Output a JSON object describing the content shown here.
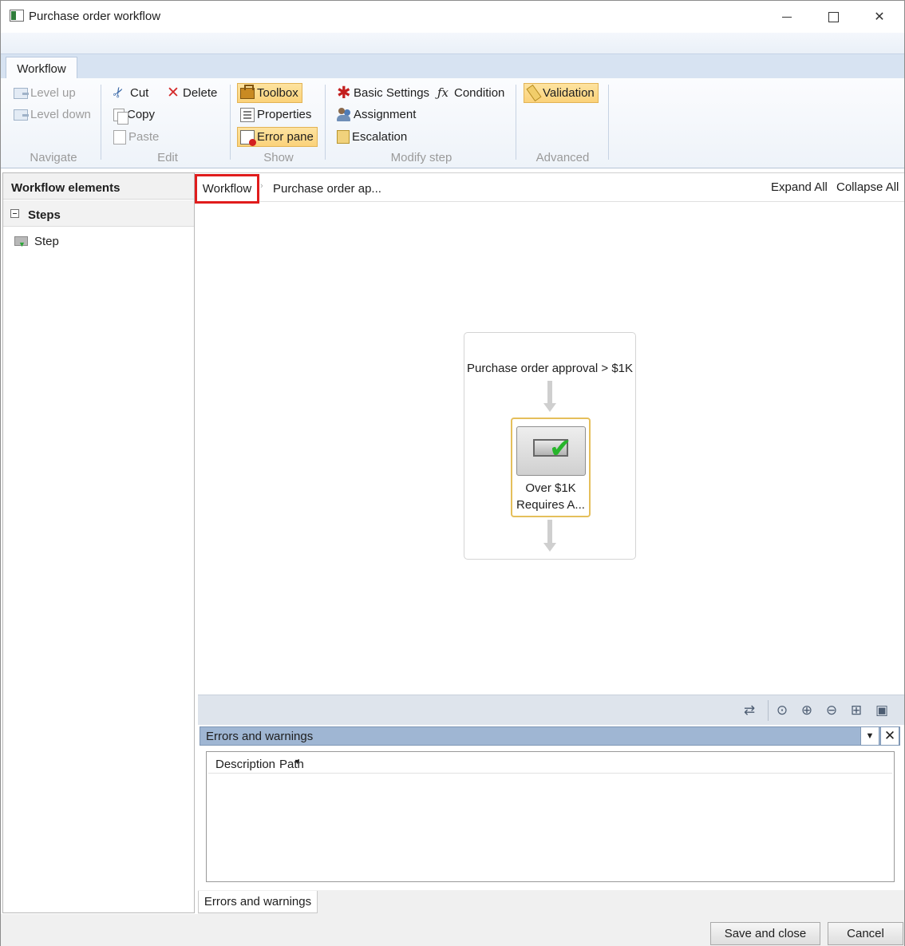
{
  "window": {
    "title": "Purchase order workflow",
    "close_glyph": "✕"
  },
  "ribbon": {
    "tab": "Workflow",
    "groups": {
      "navigate": {
        "label": "Navigate",
        "level_up": "Level up",
        "level_down": "Level down"
      },
      "edit": {
        "label": "Edit",
        "cut": "Cut",
        "delete": "Delete",
        "copy": "Copy",
        "paste": "Paste"
      },
      "show": {
        "label": "Show",
        "toolbox": "Toolbox",
        "properties": "Properties",
        "error_pane": "Error pane"
      },
      "modify_step": {
        "label": "Modify step",
        "basic_settings": "Basic Settings",
        "condition": "Condition",
        "assignment": "Assignment",
        "escalation": "Escalation"
      },
      "advanced": {
        "label": "Advanced",
        "validation": "Validation"
      }
    }
  },
  "left_panel": {
    "header": "Workflow elements",
    "section": "Steps",
    "items": [
      {
        "label": "Step"
      }
    ]
  },
  "designer": {
    "breadcrumb": {
      "current": "Workflow",
      "separator": "›",
      "next": "Purchase order ap..."
    },
    "expand_all": "Expand All",
    "collapse_all": "Collapse All",
    "flow": {
      "title": "Purchase order approval > $1K",
      "step_line1": "Over $1K",
      "step_line2": "Requires A..."
    }
  },
  "toolbar_icons": [
    "connector-icon",
    "zoom-select-icon",
    "zoom-in-icon",
    "zoom-out-icon",
    "fit-to-screen-icon",
    "actual-size-icon"
  ],
  "error_pane": {
    "title": "Errors and warnings",
    "dropdown_glyph": "▼",
    "close_glyph": "✕",
    "columns": [
      "Description",
      "Path"
    ],
    "tab": "Errors and warnings"
  },
  "footer": {
    "save_and_close": "Save and close",
    "cancel": "Cancel"
  },
  "colors": {
    "highlight_border": "#e01c1c",
    "active_button": "#fbd27a",
    "pane_header": "#9fb6d3"
  }
}
